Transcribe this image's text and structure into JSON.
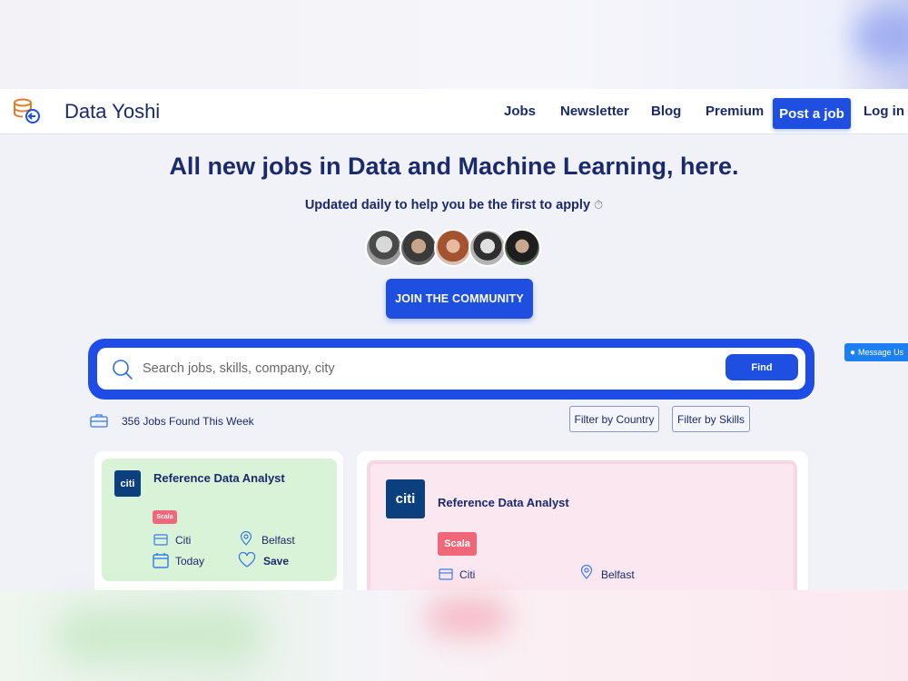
{
  "brand": {
    "name": "Data Yoshi"
  },
  "nav": {
    "jobs": "Jobs",
    "newsletter": "Newsletter",
    "blog": "Blog",
    "premium": "Premium",
    "post_job": "Post a job",
    "login": "Log in"
  },
  "hero": {
    "title": "All new jobs in Data and Machine Learning, here.",
    "subtitle": "Updated daily to help you be the first to apply",
    "join_label": "JOIN THE COMMUNITY"
  },
  "search": {
    "placeholder": "Search jobs, skills, company, city",
    "find_label": "Find"
  },
  "messenger": {
    "label": "Message Us"
  },
  "results": {
    "count_text": "356 Jobs Found This Week",
    "filter_country": "Filter by Country",
    "filter_skills": "Filter by Skills"
  },
  "jobs": [
    {
      "title": "Reference Data Analyst",
      "logo": "citi",
      "tag": "Scala",
      "company": "Citi",
      "location": "Belfast",
      "posted": "Today",
      "save_label": "Save"
    },
    {
      "title": "Reference Data Analyst",
      "logo": "citi",
      "tag": "Scala",
      "company": "Citi",
      "location": "Belfast"
    }
  ],
  "colors": {
    "navy": "#1b2a6b",
    "primary": "#1e4fe0",
    "tag": "#f0677a",
    "card_green": "#d8f3d8",
    "card_pink": "#fbe7ef"
  }
}
